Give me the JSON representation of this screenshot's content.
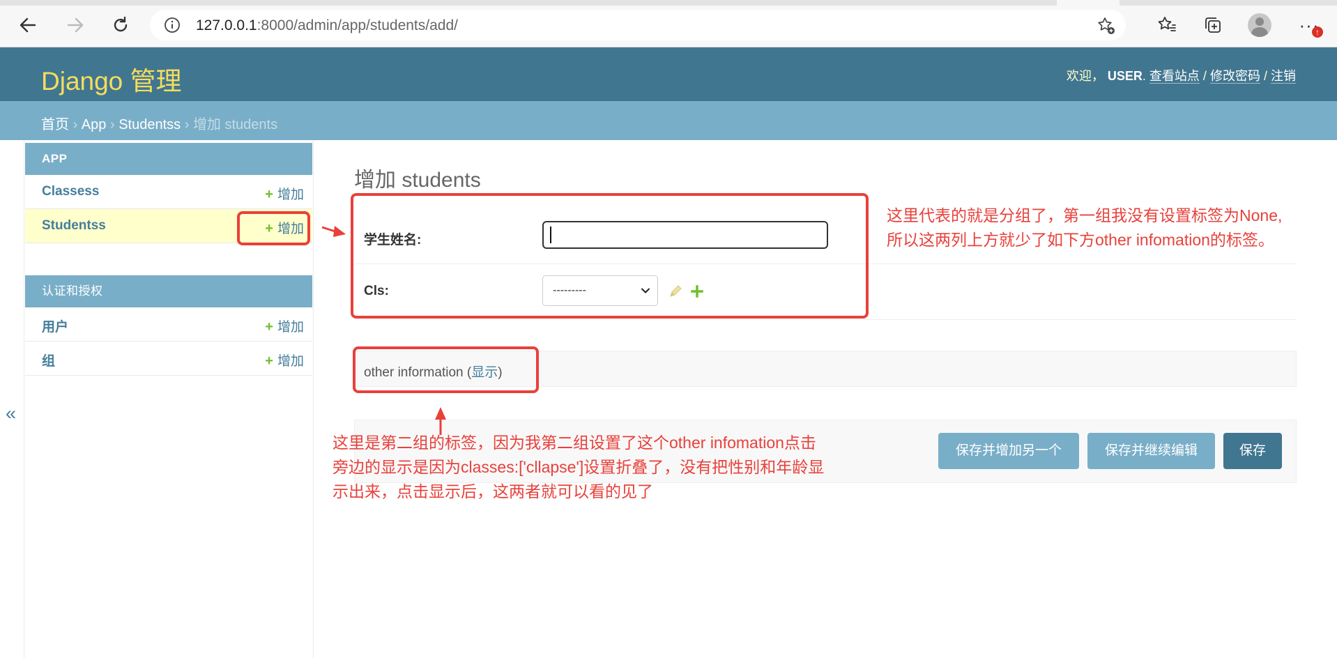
{
  "browser": {
    "url_host": "127.0.0.1",
    "url_rest": ":8000/admin/app/students/add/",
    "icons": [
      "back-icon",
      "forward-icon",
      "refresh-icon",
      "info-icon",
      "favorite-add-icon",
      "favorites-icon",
      "collections-icon",
      "profile-icon",
      "more-icon"
    ]
  },
  "header": {
    "brand": "Django 管理",
    "welcome": "欢迎，",
    "username": "USER",
    "dot": ".",
    "view_site": "查看站点",
    "slash1": "/",
    "change_password": "修改密码",
    "slash2": "/",
    "logout": "注销"
  },
  "breadcrumbs": {
    "home": "首页",
    "sep": "›",
    "app": "App",
    "model": "Studentss",
    "current": "增加 students"
  },
  "sidebar": {
    "app_caption": "APP",
    "app_models": [
      {
        "name": "Classess",
        "add": "增加"
      },
      {
        "name": "Studentss",
        "add": "增加"
      }
    ],
    "auth_caption": "认证和授权",
    "auth_models": [
      {
        "name": "用户",
        "add": "增加"
      },
      {
        "name": "组",
        "add": "增加"
      }
    ],
    "collapse_glyph": "«"
  },
  "content": {
    "title": "增加 students",
    "fields": {
      "name_label": "学生姓名:",
      "name_value": "",
      "cls_label": "Cls:",
      "cls_selected": "---------"
    },
    "fieldset": {
      "caption": "other information",
      "open_paren": "(",
      "toggle": "显示",
      "close_paren": ")"
    },
    "buttons": {
      "save_add_another": "保存并增加另一个",
      "save_continue": "保存并继续编辑",
      "save": "保存"
    }
  },
  "annotations": {
    "note1": "这里代表的就是分组了，第一组我没有设置标签为None,所以这两列上方就少了如下方other infomation的标签。",
    "note2": "这里是第二组的标签，因为我第二组设置了这个other infomation点击旁边的显示是因为classes:['cllapse']设置折叠了，没有把性别和年龄显示出来，点击显示后，这两者就可以看的见了",
    "color": "#e8413b"
  },
  "colors": {
    "header_bg": "#417690",
    "breadcrumb_bg": "#79aec8",
    "brand": "#f5dd5d",
    "link": "#447e9b",
    "add_plus": "#70bf2b",
    "current_row": "#ffffcc"
  }
}
